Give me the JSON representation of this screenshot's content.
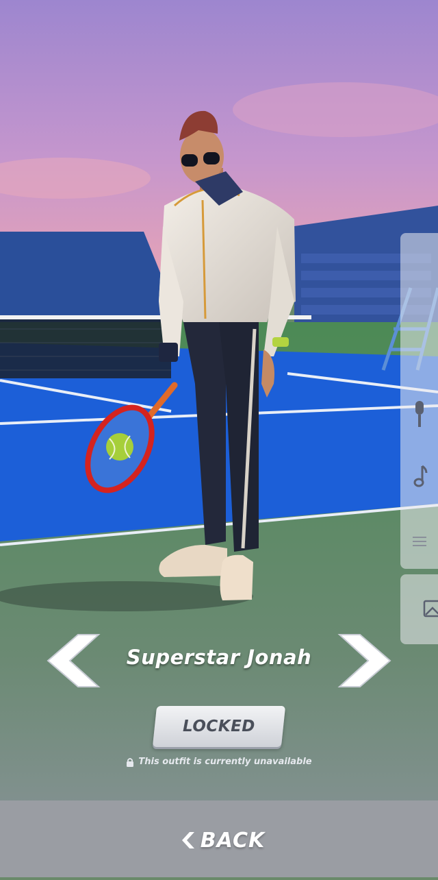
{
  "outfit": {
    "name": "Superstar Jonah",
    "lock_button_label": "LOCKED",
    "status_note": "This outfit is currently unavailable"
  },
  "navigation": {
    "back_label": "BACK",
    "prev_icon": "chevron-left-icon",
    "next_icon": "chevron-right-icon"
  },
  "side_panel": {
    "icons": [
      "microphone-icon",
      "music-note-icon",
      "sliders-icon",
      "image-icon"
    ]
  },
  "colors": {
    "sky_top": "#a98cd0",
    "sky_horizon": "#e6a2b8",
    "court_blue": "#1c5fd8",
    "court_green": "#4f8d57",
    "racket_red": "#d4231f",
    "bottom_bar": "#9a9da3"
  }
}
